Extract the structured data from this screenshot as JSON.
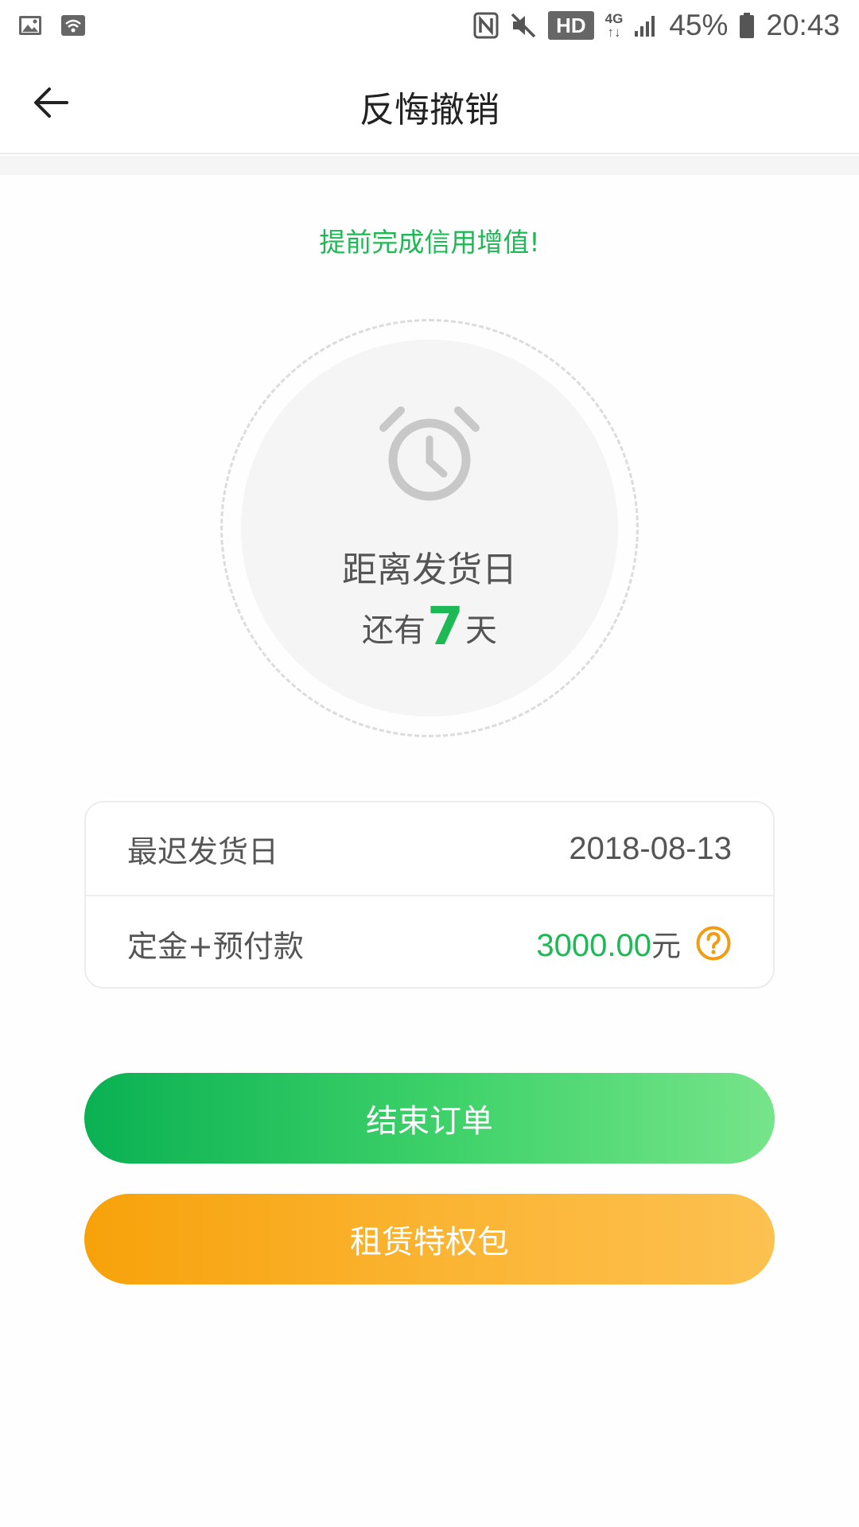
{
  "status_bar": {
    "battery": "45%",
    "time": "20:43",
    "hd": "HD",
    "network": "4G",
    "icons": [
      "gallery-icon",
      "wifi-icon",
      "nfc-icon",
      "mute-icon",
      "hd-icon",
      "signal-icon",
      "battery-icon"
    ]
  },
  "header": {
    "title": "反悔撤销",
    "back_icon": "arrow-left-icon"
  },
  "promo_text": "提前完成信用增值!",
  "countdown": {
    "label": "距离发货日",
    "prefix": "还有",
    "days": "7",
    "suffix": "天",
    "icon": "alarm-clock-icon"
  },
  "info": {
    "rows": [
      {
        "label": "最迟发货日",
        "value": "2018-08-13"
      },
      {
        "label": "定金+预付款",
        "value": "3000.00",
        "unit": "元",
        "icon": "question-circle-icon"
      }
    ]
  },
  "buttons": {
    "end_order": "结束订单",
    "privilege_pack": "租赁特权包"
  },
  "colors": {
    "accent_green": "#1db954",
    "accent_orange": "#f7a20a",
    "help_icon_orange": "#f39c12"
  }
}
